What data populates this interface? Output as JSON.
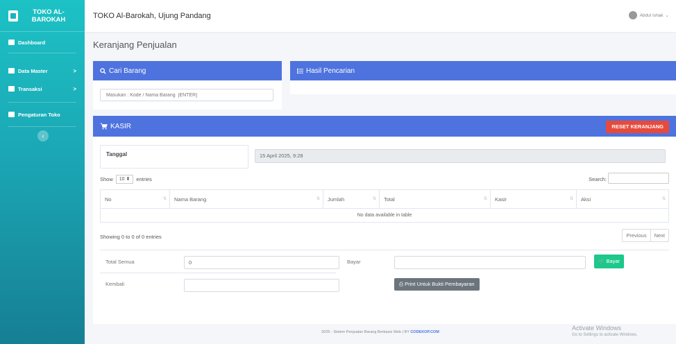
{
  "sidebar": {
    "brand": "TOKO AL-BAROKAH",
    "items": [
      {
        "label": "Dashboard",
        "icon": "dashboard-icon"
      },
      {
        "label": "Data Master",
        "icon": "database-icon",
        "chevron": ">"
      },
      {
        "label": "Transaksi",
        "icon": "desktop-icon",
        "chevron": ">"
      },
      {
        "label": "Pengaturan Toko",
        "icon": "cogs-icon"
      }
    ],
    "toggle": "‹"
  },
  "topbar": {
    "title": "TOKO Al-Barokah, Ujung Pandang",
    "user": "Abdul Ishak"
  },
  "page": {
    "title": "Keranjang Penjualan"
  },
  "cari": {
    "title": "Cari Barang",
    "placeholder": "Masukan : Kode / Nama Barang  [ENTER]"
  },
  "hasil": {
    "title": "Hasil Pencarian"
  },
  "kasir": {
    "title": "KASIR",
    "reset_label": "RESET KERANJANG",
    "tanggal_label": "Tanggal",
    "tanggal_value": "15 April 2025, 9:28",
    "show": "Show",
    "entries_value": "10",
    "entries": "entries",
    "search_label": "Search:",
    "columns": [
      "No",
      "Nama Barang",
      "Jumlah",
      "Total",
      "Kasir",
      "Aksi"
    ],
    "empty": "No data available in table",
    "showing": "Showing 0 to 0 of 0 entries",
    "prev": "Previous",
    "next": "Next",
    "total_label": "Total Semua",
    "total_value": "0",
    "bayar_label": "Bayar",
    "bayar_btn": "Bayar",
    "kembali_label": "Kembali",
    "print_btn": "Print Untuk Bukti Pembayaran"
  },
  "footer": {
    "text": "2025 - Sistem Penjualan Barang Berbasis Web | BY",
    "brand": "CODEKOP.COM"
  },
  "watermark": {
    "line1": "Activate Windows",
    "line2": "Go to Settings to activate Windows."
  },
  "colors": {
    "primary": "#4e73df",
    "danger": "#e74a3b",
    "success": "#1cc88a",
    "secondary": "#6c757d",
    "sidebar": "#1bb3bf"
  }
}
